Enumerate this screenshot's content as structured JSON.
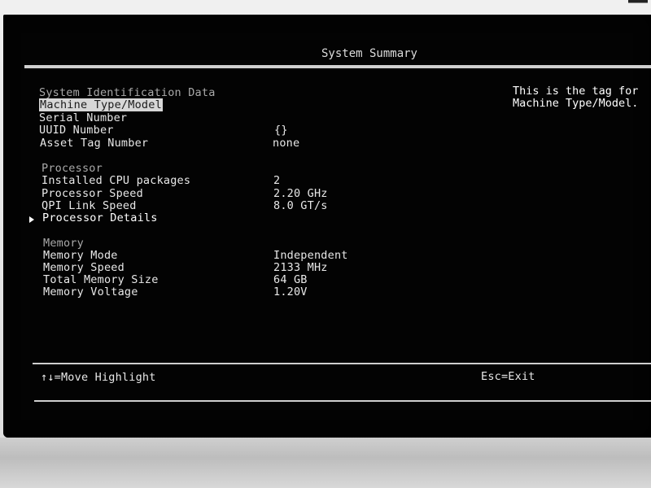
{
  "screen_title": "System Summary",
  "sections": {
    "identification": {
      "header": "System Identification Data",
      "rows": [
        {
          "label": "Machine Type/Model",
          "value": ""
        },
        {
          "label": "Serial Number",
          "value": ""
        },
        {
          "label": "UUID Number",
          "value": "{}"
        },
        {
          "label": "Asset Tag Number",
          "value": "none"
        }
      ]
    },
    "processor": {
      "header": "Processor",
      "rows": [
        {
          "label": "Installed CPU packages",
          "value": "2"
        },
        {
          "label": "Processor Speed",
          "value": "2.20 GHz"
        },
        {
          "label": "QPI Link Speed",
          "value": "8.0 GT/s"
        }
      ],
      "submenu_label": "Processor Details"
    },
    "memory": {
      "header": "Memory",
      "rows": [
        {
          "label": "Memory Mode",
          "value": "Independent"
        },
        {
          "label": "Memory Speed",
          "value": "2133 MHz"
        },
        {
          "label": "Total Memory Size",
          "value": "64 GB"
        },
        {
          "label": "Memory Voltage",
          "value": "1.20V"
        }
      ]
    }
  },
  "help_text": {
    "line1": "This is the tag for",
    "line2": "Machine Type/Model."
  },
  "footer": {
    "move_hint": "↑↓=Move Highlight",
    "exit_hint": "Esc=Exit"
  },
  "icons": {
    "submenu": "triangle-right-icon"
  },
  "colors": {
    "screen_background": "#030303",
    "text": "#e8e8e8",
    "highlight_background": "#d7d7d7",
    "divider": "#cfcfcf"
  }
}
